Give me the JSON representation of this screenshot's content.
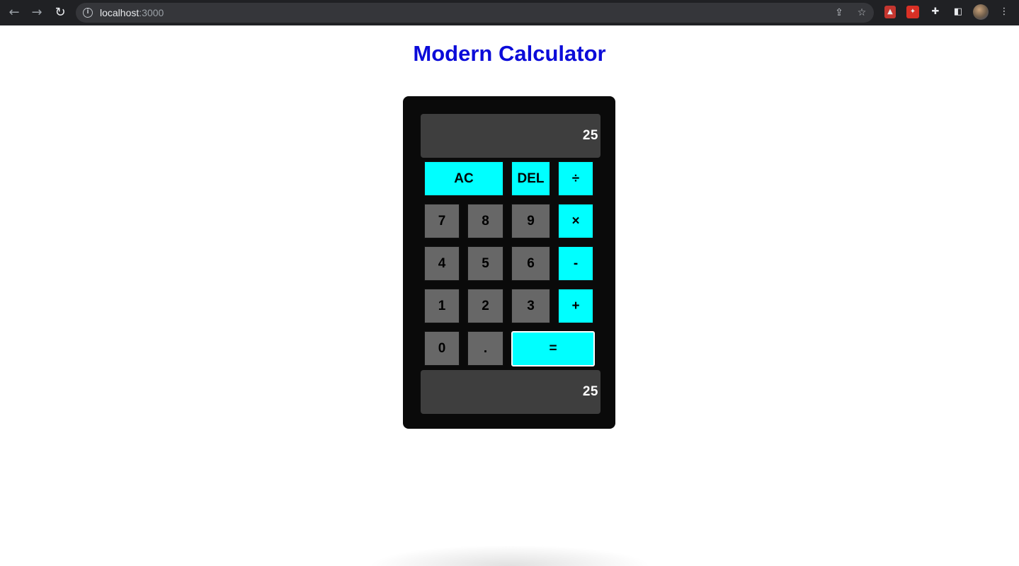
{
  "browser": {
    "url_host": "localhost",
    "url_port": ":3000",
    "icons": {
      "back": "arrow-left-icon",
      "forward": "arrow-right-icon",
      "reload": "reload-icon",
      "info": "info-icon",
      "share": "share-icon",
      "bookmark": "star-icon",
      "extensions": "puzzle-icon",
      "sidebar": "sidebar-icon",
      "menu": "kebab-menu-icon"
    }
  },
  "page": {
    "title": "Modern Calculator"
  },
  "calculator": {
    "display_top": "25",
    "display_bottom": "25",
    "keys": {
      "ac": "AC",
      "del": "DEL",
      "divide": "÷",
      "seven": "7",
      "eight": "8",
      "nine": "9",
      "multiply": "×",
      "four": "4",
      "five": "5",
      "six": "6",
      "minus": "-",
      "one": "1",
      "two": "2",
      "three": "3",
      "plus": "+",
      "zero": "0",
      "dot": ".",
      "equals": "="
    }
  },
  "colors": {
    "title": "#0b0bd9",
    "calculator_body": "#0a0a0a",
    "display": "#3e3e3e",
    "number_key": "#676767",
    "operator_key": "#00ffff"
  }
}
